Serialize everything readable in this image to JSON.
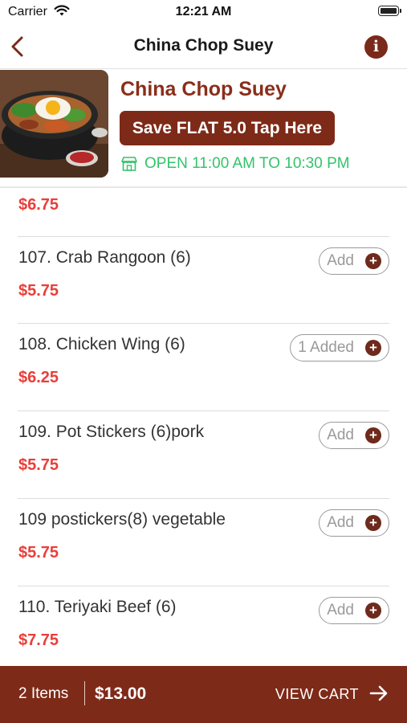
{
  "status_bar": {
    "carrier": "Carrier",
    "time": "12:21 AM"
  },
  "nav": {
    "title": "China Chop Suey"
  },
  "restaurant": {
    "name": "China Chop Suey",
    "promo": "Save FLAT 5.0 Tap Here",
    "hours": "OPEN 11:00 AM TO 10:30 PM"
  },
  "menu": {
    "top_price": "$6.75",
    "items": [
      {
        "name": "107. Crab Rangoon (6)",
        "price": "$5.75",
        "button": "Add"
      },
      {
        "name": "108. Chicken Wing (6)",
        "price": "$6.25",
        "button": "1 Added"
      },
      {
        "name": "109. Pot Stickers (6)pork",
        "price": "$5.75",
        "button": "Add"
      },
      {
        "name": "109 postickers(8) vegetable",
        "price": "$5.75",
        "button": "Add"
      },
      {
        "name": "110. Teriyaki Beef (6)",
        "price": "$7.75",
        "button": "Add"
      }
    ]
  },
  "cart": {
    "count": "2 Items",
    "total": "$13.00",
    "action": "VIEW CART"
  },
  "colors": {
    "brand": "#7e2a18",
    "price": "#e93e39",
    "open": "#33c36a"
  },
  "icons": {
    "back": "chevron-left-icon",
    "info": "info-icon",
    "store": "store-icon",
    "plus": "plus-circle-icon",
    "arrow": "arrow-right-icon"
  }
}
